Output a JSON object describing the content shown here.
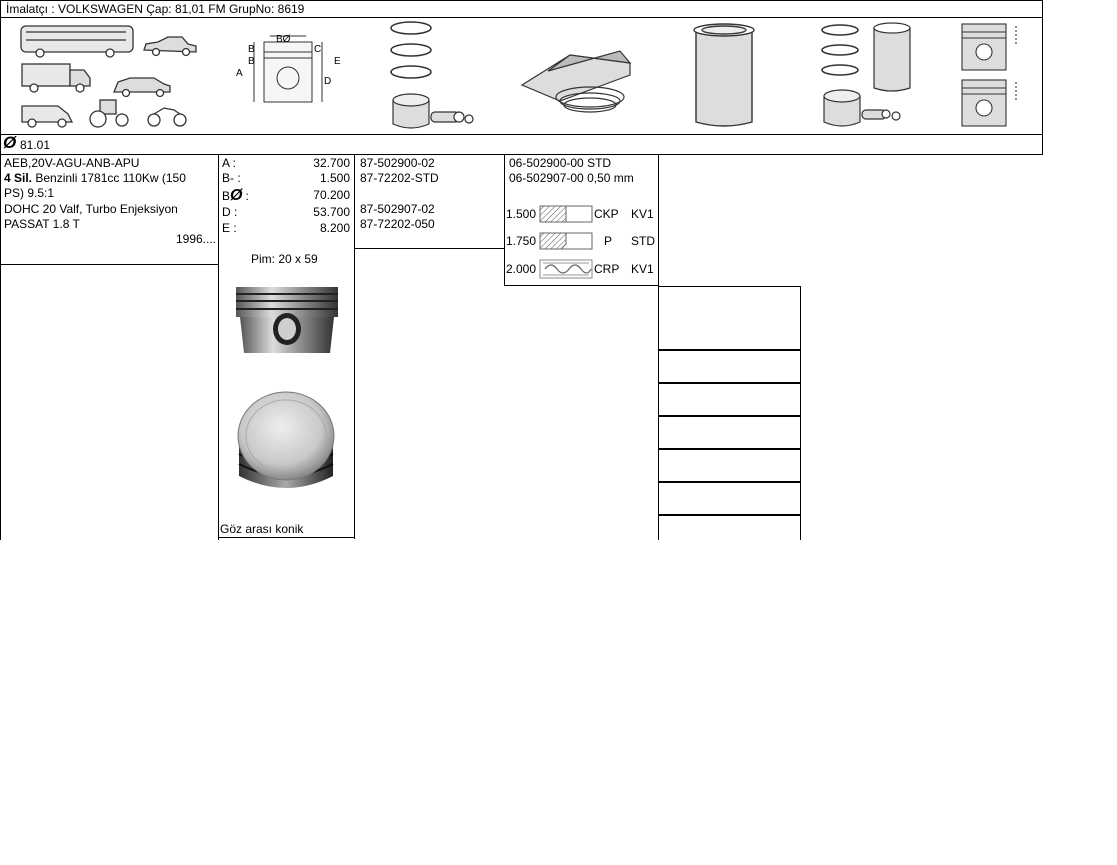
{
  "header": {
    "line": "İmalatçı : VOLKSWAGEN   Çap: 81,01  FM GrupNo: 8619"
  },
  "icons": {
    "vehicles": "vehicle-types-icon",
    "piston_diagram": "piston-dimension-diagram-icon",
    "rings_piston": "piston-rings-pin-icon",
    "ring_installer": "ring-compressor-icon",
    "liner": "cylinder-liner-icon",
    "kit": "piston-kit-icon",
    "pistons_side": "piston-side-views-icon"
  },
  "diagram_labels": {
    "a": "A",
    "b": "B",
    "b0": "BØ",
    "c": "C",
    "d": "D",
    "e": "E"
  },
  "bore": {
    "symbol": "Ø",
    "value": "81.01"
  },
  "engine": {
    "codes": " AEB,20V-AGU-ANB-APU",
    "cyl_bold": "4 Sil.",
    "desc1": "  Benzinli 1781cc 110Kw (150",
    "desc2": "PS) 9.5:1",
    "desc3": " DOHC 20 Valf, Turbo Enjeksiyon",
    "model": "PASSAT 1.8 T",
    "year": "1996...."
  },
  "dims": [
    {
      "label": "A :",
      "value": "32.700"
    },
    {
      "label": "B- :",
      "value": "1.500"
    },
    {
      "label": "B",
      "symbol": "Ø",
      "tail": ":",
      "value": "70.200"
    },
    {
      "label": "D :",
      "value": "53.700"
    },
    {
      "label": "E :",
      "value": "8.200"
    }
  ],
  "pin": "Pim: 20 x 59",
  "piston_note": "Göz arası konik",
  "part_numbers": [
    "87-502900-02",
    "87-72202-STD",
    "87-502907-02",
    "87-72202-050"
  ],
  "rings": {
    "sets": [
      "06-502900-00 STD",
      "06-502907-00 0,50 mm"
    ],
    "items": [
      {
        "width": "1.500",
        "code": "CKP",
        "mat": "KV1"
      },
      {
        "width": "1.750",
        "code": "P",
        "mat": "STD"
      },
      {
        "width": "2.000",
        "code": "CRP",
        "mat": "KV1"
      }
    ]
  }
}
